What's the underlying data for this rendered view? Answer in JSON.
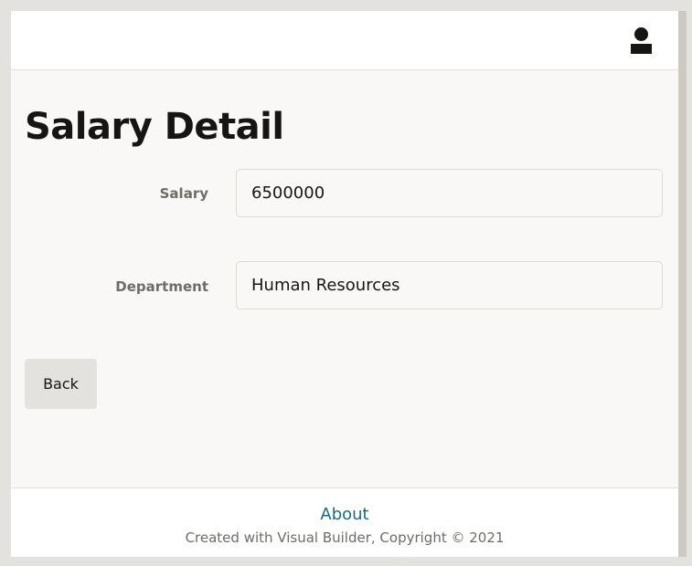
{
  "header": {
    "avatar_icon": "user-avatar-icon"
  },
  "page": {
    "title": "Salary Detail"
  },
  "form": {
    "salary": {
      "label": "Salary",
      "value": "6500000"
    },
    "department": {
      "label": "Department",
      "value": "Human Resources"
    }
  },
  "actions": {
    "back_label": "Back"
  },
  "footer": {
    "about_label": "About",
    "copyright": "Created with Visual Builder, Copyright © 2021"
  },
  "colors": {
    "background": "#faf8f6",
    "text": "#161513",
    "link": "#1e6a7c",
    "button": "#e4e2df"
  }
}
